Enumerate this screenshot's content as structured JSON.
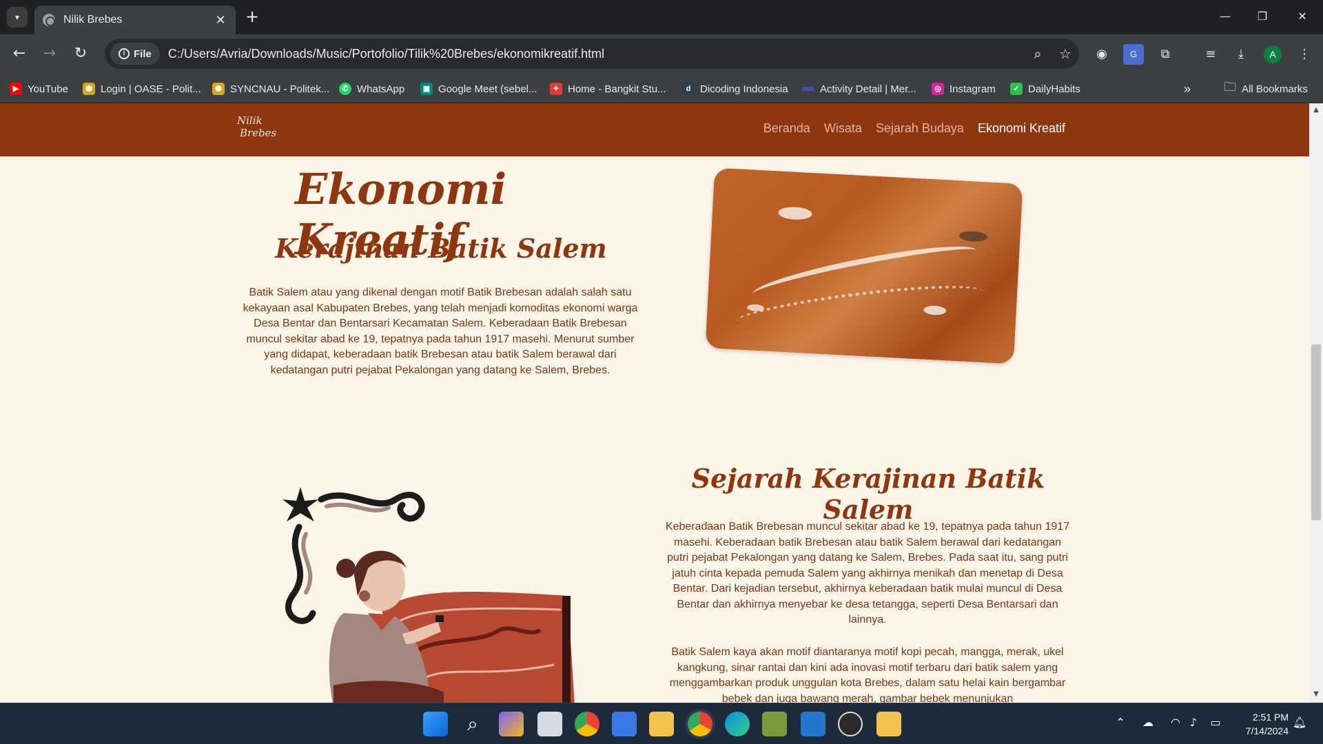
{
  "browser": {
    "tab_title": "Nilik Brebes",
    "url_scheme_chip": "File",
    "url": "C:/Users/Avria/Downloads/Music/Portofolio/Tilik%20Brebes/ekonomikreatif.html",
    "avatar_letter": "A",
    "bookmarks": [
      {
        "label": "YouTube",
        "color": "#ff0000",
        "icon": "youtube-icon"
      },
      {
        "label": "Login | OASE - Polit...",
        "color": "#d9a521",
        "icon": "oase-icon"
      },
      {
        "label": "SYNCNAU - Politek...",
        "color": "#d9a521",
        "icon": "syncnau-icon"
      },
      {
        "label": "WhatsApp",
        "color": "#25d366",
        "icon": "whatsapp-icon"
      },
      {
        "label": "Google Meet (sebel...",
        "color": "#00897b",
        "icon": "google-meet-icon"
      },
      {
        "label": "Home - Bangkit Stu...",
        "color": "#e53935",
        "icon": "bangkit-icon"
      },
      {
        "label": "Dicoding Indonesia",
        "color": "#2d3e50",
        "icon": "dicoding-icon"
      },
      {
        "label": "Activity Detail | Mer...",
        "color": "#3f51b5",
        "icon": "activity-icon"
      },
      {
        "label": "Instagram",
        "color": "#d6249f",
        "icon": "instagram-icon"
      },
      {
        "label": "DailyHabits",
        "color": "#2fbf4f",
        "icon": "dailyhabits-icon"
      }
    ],
    "all_bookmarks_label": "All Bookmarks"
  },
  "site": {
    "logo_line1": "Nilik",
    "logo_line2": "Brebes",
    "nav": [
      {
        "label": "Beranda",
        "active": false
      },
      {
        "label": "Wisata",
        "active": false
      },
      {
        "label": "Sejarah Budaya",
        "active": false
      },
      {
        "label": "Ekonomi Kreatif",
        "active": true
      }
    ],
    "page_title": "Ekonomi Kreatif",
    "section1": {
      "heading": "Kerajinan Batik Salem",
      "text": "Batik Salem atau yang dikenal dengan motif Batik Brebesan adalah salah satu kekayaan asal Kabupaten Brebes, yang telah menjadi komoditas ekonomi warga Desa Bentar dan Bentarsari Kecamatan Salem. Keberadaan Batik Brebesan muncul sekitar abad ke 19, tepatnya pada tahun 1917 masehi. Menurut sumber yang didapat, keberadaan batik Brebesan atau batik Salem berawal dari kedatangan putri pejabat Pekalongan yang datang ke Salem, Brebes."
    },
    "section2": {
      "heading": "Sejarah Kerajinan Batik Salem",
      "text1": "Keberadaan Batik Brebesan muncul sekitar abad ke 19, tepatnya pada tahun 1917 masehi. Keberadaan batik Brebesan atau batik Salem berawal dari kedatangan putri pejabat Pekalongan yang datang ke Salem, Brebes. Pada saat itu, sang putri jatuh cinta kepada pemuda Salem yang akhirnya menikah dan menetap di Desa Bentar. Dari kejadian tersebut, akhirnya keberadaan batik mulai muncul di Desa Bentar dan akhirnya menyebar ke desa tetangga, seperti Desa Bentarsari dan lainnya.",
      "text2": "Batik Salem kaya akan motif diantaranya motif kopi pecah, mangga, merak, ukel kangkung, sinar rantai dan kini ada inovasi motif terbaru dari batik salem yang menggambarkan produk unggulan kota Brebes, dalam satu helai kain bergambar bebek dan juga bawang merah, gambar bebek menunjukan"
    }
  },
  "taskbar": {
    "time": "2:51 PM",
    "date": "7/14/2024"
  },
  "colors": {
    "brand_brown": "#8d3610",
    "page_bg": "#fcf5e8",
    "text_brown": "#7a3516"
  }
}
